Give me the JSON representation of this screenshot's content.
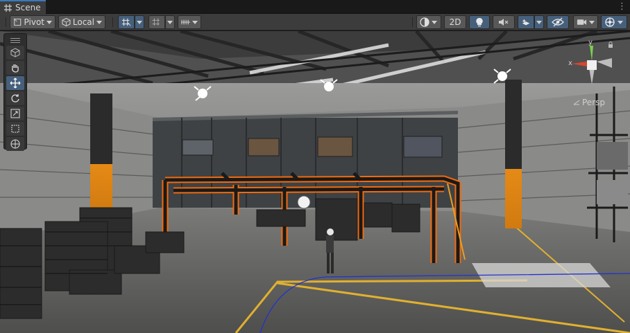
{
  "tab": {
    "icon": "grid-icon",
    "label": "Scene",
    "menu_icon": "kebab-menu-icon"
  },
  "toolbar": {
    "pivot_label": "Pivot",
    "local_label": "Local",
    "mode_2d_label": "2D",
    "icons": [
      "hand-tool-icon",
      "grid-snap-icon",
      "increment-snap-icon",
      "shading-mode-icon",
      "lighting-icon",
      "audio-icon",
      "effects-icon",
      "visibility-icon",
      "camera-icon",
      "gizmos-icon"
    ]
  },
  "tools": [
    "view-cube-icon",
    "hand-tool-icon",
    "move-tool-icon",
    "rotate-tool-icon",
    "scale-tool-icon",
    "rect-tool-icon",
    "transform-tool-icon"
  ],
  "view": {
    "projection_label": "Persp",
    "axis_y": "y",
    "axis_x": "x"
  },
  "colors": {
    "accent": "#3a79bb",
    "selection_outline": "#f26b0f",
    "active_button": "#46607c",
    "toolbar_bg": "#3c3c3c"
  }
}
